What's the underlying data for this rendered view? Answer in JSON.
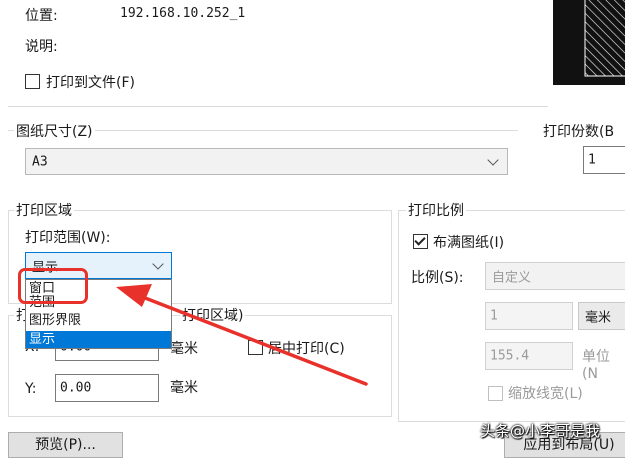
{
  "printer": {
    "location_label": "位置:",
    "location_value": "192.168.10.252_1",
    "description_label": "说明:",
    "print_to_file_label": "打印到文件(F)"
  },
  "paper_size": {
    "group_label": "图纸尺寸(Z)",
    "selected": "A3"
  },
  "copies": {
    "label": "打印份数(B",
    "value": "1"
  },
  "plot_area": {
    "group_label": "打印区域",
    "range_label": "打印范围(W):",
    "selected": "显示",
    "options": [
      "窗口",
      "范围",
      "图形界限",
      "显示"
    ],
    "highlighted_index": 3
  },
  "plot_offset": {
    "group_label_partial": "打",
    "group_label_tail": "打印区域)",
    "x_label": "X:",
    "x_value": "0.00",
    "y_label": "Y:",
    "y_value": "0.00",
    "unit_x": "毫米",
    "unit_y": "毫米",
    "center_label": "居中打印(C)"
  },
  "plot_scale": {
    "group_label": "打印比例",
    "fit_paper_label": "布满图纸(I)",
    "scale_label": "比例(S):",
    "scale_selected": "自定义",
    "value1": "1",
    "unit1": "毫米",
    "value2": "155.4",
    "unit2": "单位(N",
    "lineweights_label": "缩放线宽(L)"
  },
  "buttons": {
    "preview": "预览(P)...",
    "apply_layout": "应用到布局(U)"
  },
  "watermark": "头条@小李哥是我",
  "colors": {
    "annotation_red": "#e8312a",
    "selection_blue": "#0078d7"
  }
}
